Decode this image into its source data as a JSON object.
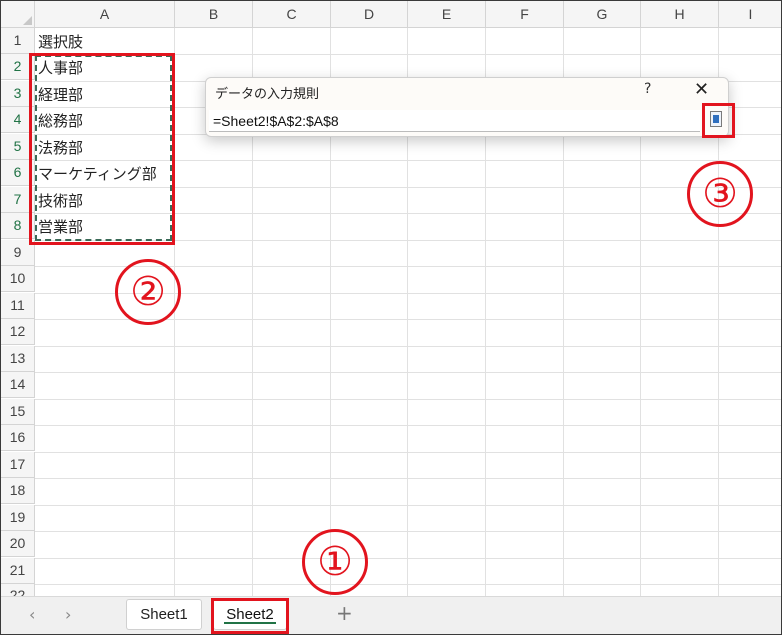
{
  "columns": [
    "A",
    "B",
    "C",
    "D",
    "E",
    "F",
    "G",
    "H",
    "I"
  ],
  "rows": [
    "1",
    "2",
    "3",
    "4",
    "5",
    "6",
    "7",
    "8",
    "9",
    "10",
    "11",
    "12",
    "13",
    "14",
    "15",
    "16",
    "17",
    "18",
    "19",
    "20",
    "21",
    "22"
  ],
  "cells": {
    "a1": "選択肢",
    "a2": "人事部",
    "a3": "経理部",
    "a4": "総務部",
    "a5": "法務部",
    "a6": "マーケティング部",
    "a7": "技術部",
    "a8": "営業部"
  },
  "dialog": {
    "title": "データの入力規則",
    "help": "?",
    "close": "✕",
    "formula": "=Sheet2!$A$2:$A$8"
  },
  "tabs": {
    "prev": "‹",
    "next": "›",
    "sheet1": "Sheet1",
    "sheet2": "Sheet2",
    "add": "+"
  },
  "annotations": {
    "one": "①",
    "two": "②",
    "three": "③"
  },
  "colors": {
    "accent_green": "#217346",
    "annotation_red": "#e2141e"
  }
}
